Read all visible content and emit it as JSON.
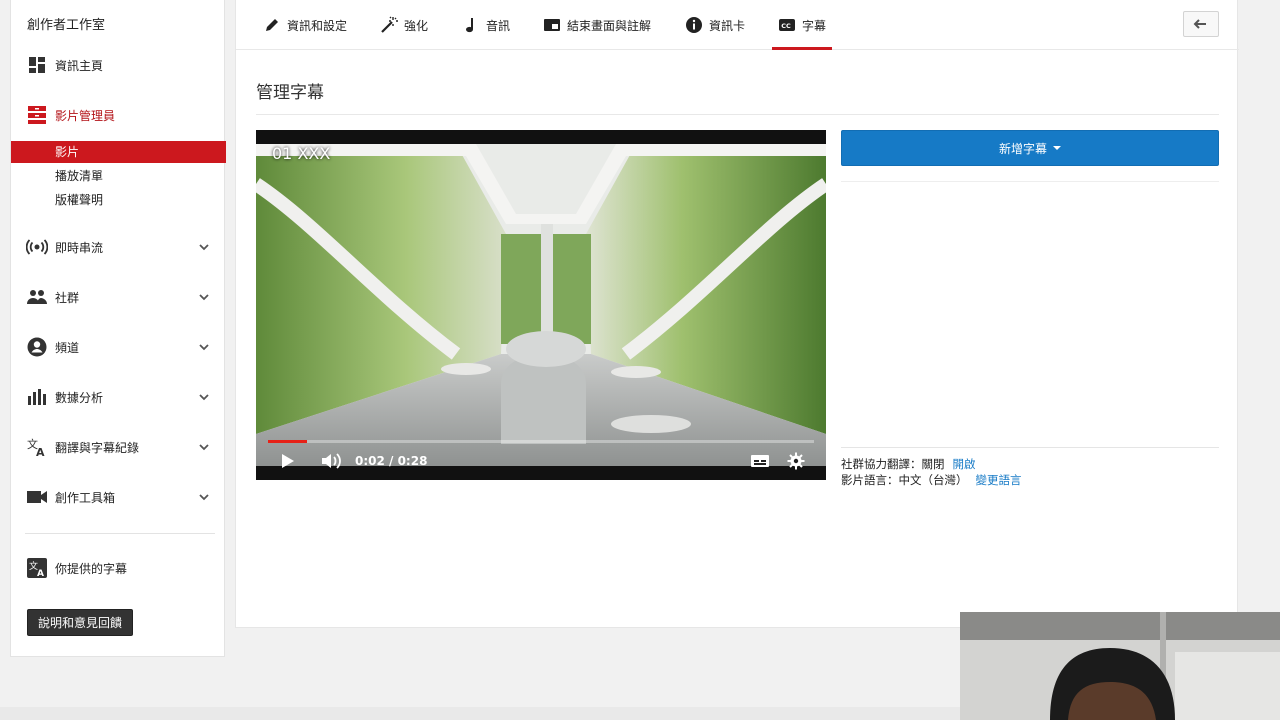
{
  "sidebar": {
    "brand": "創作者工作室",
    "items": [
      {
        "label": "資訊主頁",
        "icon": "dashboard-icon"
      },
      {
        "label": "影片管理員",
        "icon": "video-manager-icon"
      },
      {
        "label": "即時串流",
        "icon": "live-stream-icon"
      },
      {
        "label": "社群",
        "icon": "community-icon"
      },
      {
        "label": "頻道",
        "icon": "channel-icon"
      },
      {
        "label": "數據分析",
        "icon": "analytics-icon"
      },
      {
        "label": "翻譯與字幕紀錄",
        "icon": "translate-icon"
      },
      {
        "label": "創作工具箱",
        "icon": "toolbox-icon"
      },
      {
        "label": "你提供的字幕",
        "icon": "translate-icon"
      }
    ],
    "sub_items": [
      "影片",
      "播放清單",
      "版權聲明"
    ],
    "help_button": "說明和意見回饋"
  },
  "tabs": [
    {
      "label": "資訊和設定",
      "icon": "pencil-icon"
    },
    {
      "label": "強化",
      "icon": "magic-wand-icon"
    },
    {
      "label": "音訊",
      "icon": "music-note-icon"
    },
    {
      "label": "結束畫面與註解",
      "icon": "end-screen-icon"
    },
    {
      "label": "資訊卡",
      "icon": "info-icon"
    },
    {
      "label": "字幕",
      "icon": "cc-icon"
    }
  ],
  "page": {
    "title": "管理字幕"
  },
  "video": {
    "title": "01 XXX",
    "current_time": "0:02",
    "duration": "0:28",
    "time_display": "0:02 / 0:28",
    "progress_fraction": 0.071
  },
  "captions": {
    "add_button": "新增字幕",
    "community_label": "社群協力翻譯：關閉",
    "community_action": "開啟",
    "language_label": "影片語言：中文（台灣）",
    "language_action": "變更語言"
  },
  "colors": {
    "accent_red": "#cc181e",
    "accent_blue": "#167ac6"
  }
}
